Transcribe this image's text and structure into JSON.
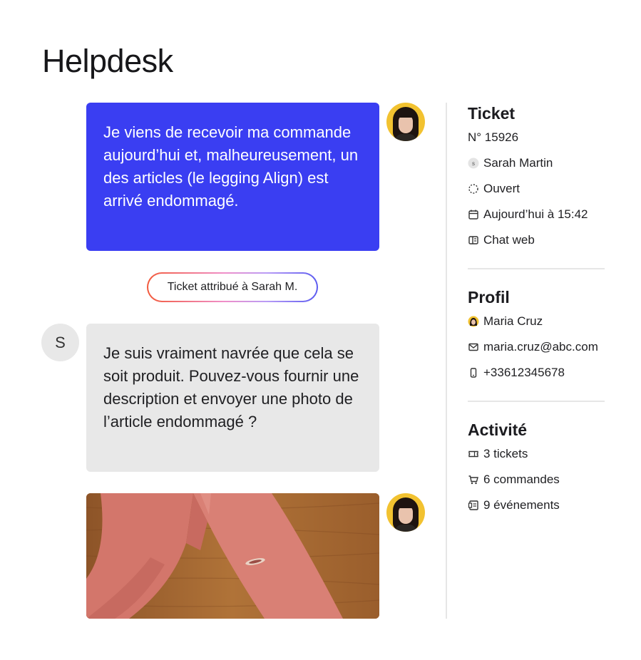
{
  "page": {
    "title": "Helpdesk"
  },
  "chat": {
    "customer_message": "Je viens de recevoir ma commande aujourd’hui et, malheureusement, un des articles (le legging Align) est arrivé endommagé.",
    "assignment_event": "Ticket attribué à Sarah M.",
    "agent_initial": "S",
    "agent_message": "Je suis vraiment navrée que cela se soit produit. Pouvez-vous fournir une description et envoyer une photo de l’article endommagé ?"
  },
  "ticket": {
    "heading": "Ticket",
    "number": "N° 15926",
    "assignee_initial": "s",
    "assignee": "Sarah Martin",
    "status": "Ouvert",
    "created": "Aujourd’hui à 15:42",
    "channel": "Chat web"
  },
  "profile": {
    "heading": "Profil",
    "name": "Maria Cruz",
    "email": "maria.cruz@abc.com",
    "phone": "+33612345678"
  },
  "activity": {
    "heading": "Activité",
    "tickets": "3 tickets",
    "orders": "6 commandes",
    "events": "9 événements"
  },
  "colors": {
    "customer_bubble": "#3a3ef2",
    "agent_bubble": "#e8e8e8",
    "avatar_bg": "#f2c230",
    "legging": "#d4786c",
    "wood": "#a86a35"
  },
  "icons": [
    "user-initial-icon",
    "status-open-icon",
    "calendar-icon",
    "chat-channel-icon",
    "mail-icon",
    "phone-icon",
    "ticket-icon",
    "cart-icon",
    "events-icon"
  ]
}
